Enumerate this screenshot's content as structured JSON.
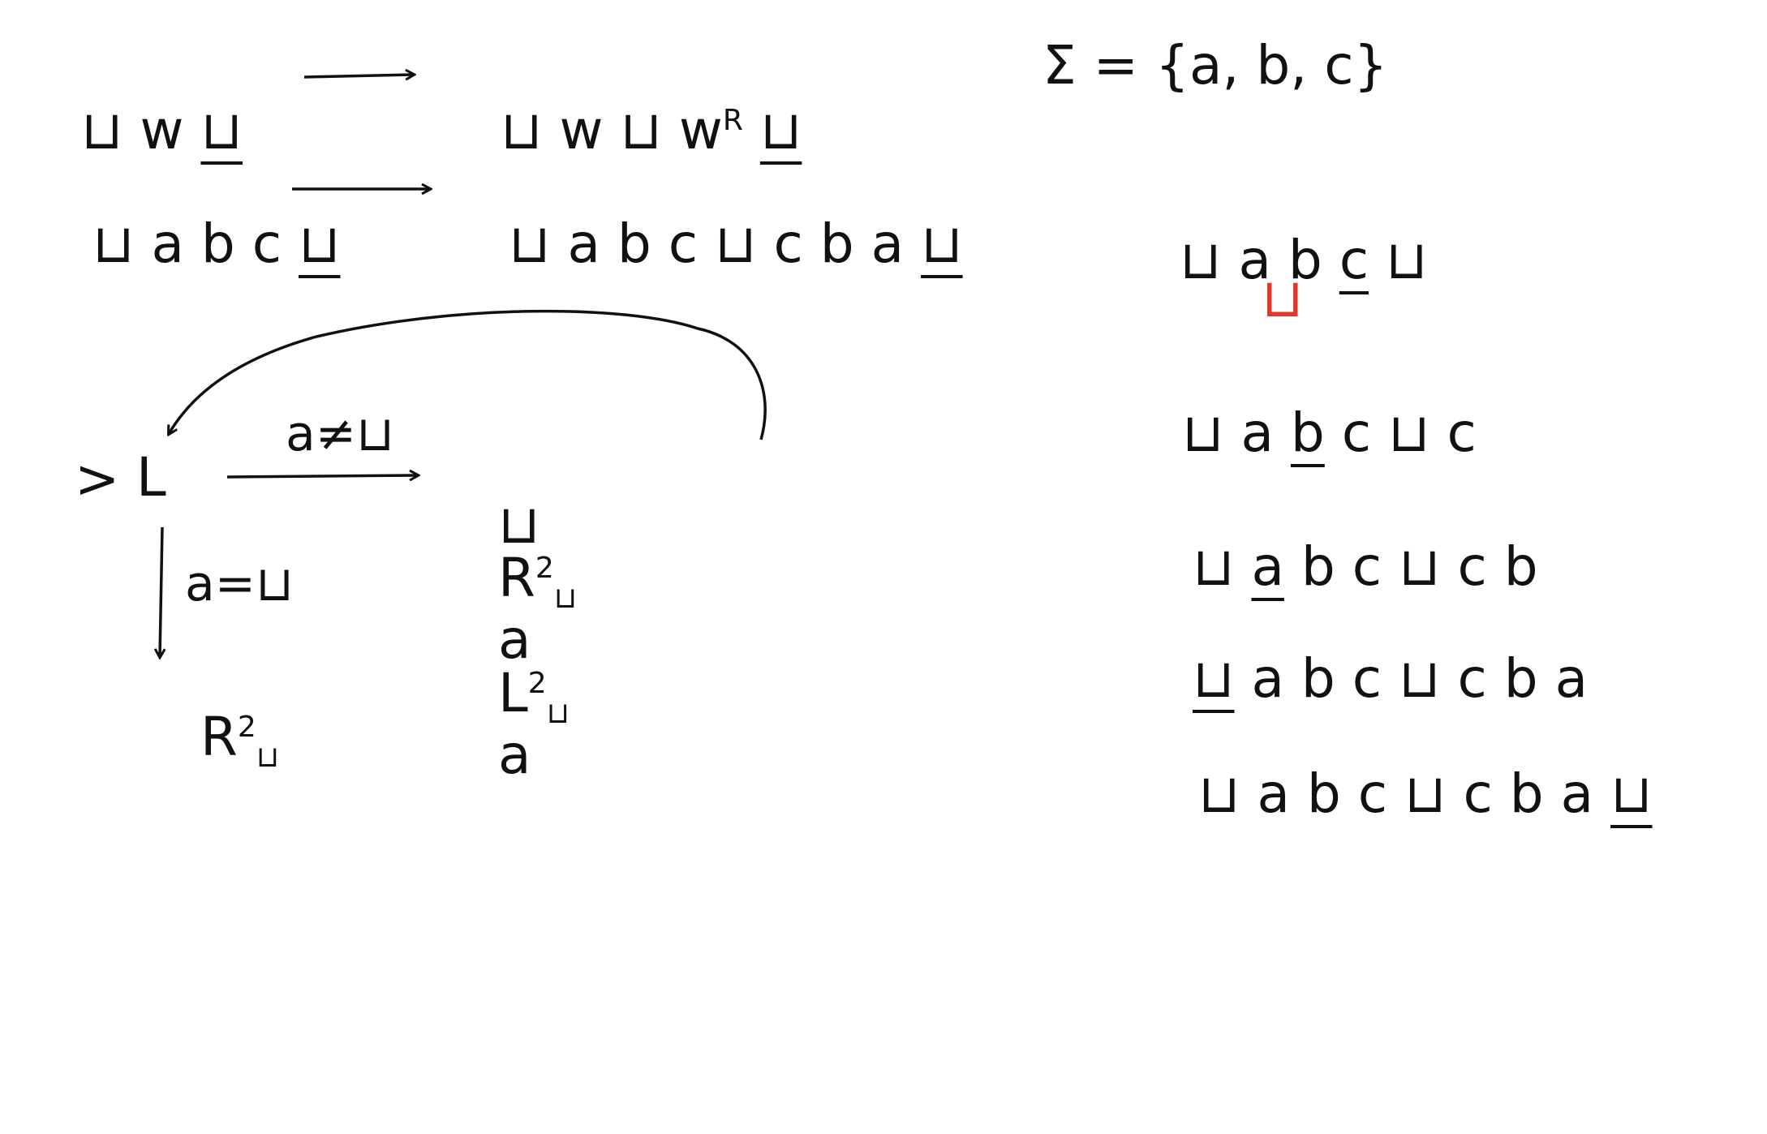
{
  "colors": {
    "ink": "#111111",
    "highlight": "#e0392b",
    "background": "#ffffff"
  },
  "left": {
    "row1": {
      "input_pre": "⊔ w ",
      "input_head": "⊔",
      "output_pre": "⊔ w ⊔ w",
      "output_sup": "R",
      "output_head": "⊔"
    },
    "row2": {
      "input_pre": "⊔ a b c ",
      "input_head": "⊔",
      "output_pre": "⊔ a b c ⊔ c b a ",
      "output_head": "⊔"
    }
  },
  "machine": {
    "start_marker": ">",
    "start_state": "L",
    "edge_neq": "a≠⊔",
    "edge_eq": "a=⊔",
    "chain": {
      "blank": "⊔",
      "R": "R",
      "R_sub": "⊔",
      "R_sup": "2",
      "a1": "a",
      "L": "L",
      "L_sub": "⊔",
      "L_sup": "2",
      "a2": "a"
    },
    "halt": {
      "R": "R",
      "R_sub": "⊔",
      "R_sup": "2"
    }
  },
  "right": {
    "sigma": "Σ = {a, b, c}",
    "trace": [
      {
        "pre": "⊔ a b ",
        "head": "c",
        "post": " ⊔"
      },
      {
        "red": "⊔"
      },
      {
        "pre": "⊔ a ",
        "head": "b",
        "post": " c ⊔ c"
      },
      {
        "pre": "⊔ ",
        "head": "a",
        "post": " b c ⊔ c b"
      },
      {
        "pre": "",
        "head": "⊔",
        "post": " a b c ⊔ c b a"
      },
      {
        "pre": "⊔ a b c ⊔ c b a ",
        "head": "⊔",
        "post": ""
      }
    ]
  }
}
